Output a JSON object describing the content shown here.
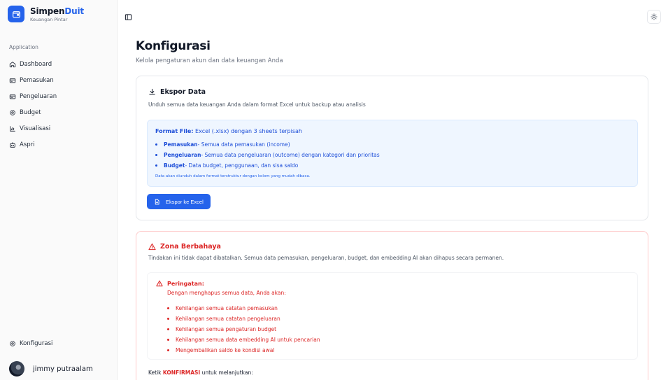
{
  "brand": {
    "name_part1": "Simpen",
    "name_part2": "Duit",
    "tagline": "Keuangan Pintar",
    "accent_color": "#2563eb"
  },
  "sidebar": {
    "group_label": "Application",
    "items": [
      {
        "label": "Dashboard",
        "icon": "home-icon"
      },
      {
        "label": "Pemasukan",
        "icon": "wallet-in-icon"
      },
      {
        "label": "Pengeluaran",
        "icon": "wallet-out-icon"
      },
      {
        "label": "Budget",
        "icon": "settings-icon"
      },
      {
        "label": "Visualisasi",
        "icon": "chart-icon"
      },
      {
        "label": "Aspri",
        "icon": "bot-icon"
      }
    ],
    "config_label": "Konfigurasi",
    "user_name": "jimmy putraalam"
  },
  "page": {
    "title": "Konfigurasi",
    "subtitle": "Kelola pengaturan akun dan data keuangan Anda"
  },
  "export": {
    "title": "Ekspor Data",
    "description": "Unduh semua data keuangan Anda dalam format Excel untuk backup atau analisis",
    "format_label": "Format File:",
    "format_value": " Excel (.xlsx) dengan 3 sheets terpisah",
    "items": [
      {
        "name": "Pemasukan",
        "desc": " - Semua data pemasukan (income)"
      },
      {
        "name": "Pengeluaran",
        "desc": " - Semua data pengeluaran (outcome) dengan kategori dan prioritas"
      },
      {
        "name": "Budget",
        "desc": " - Data budget, penggunaan, dan sisa saldo"
      }
    ],
    "note": "Data akan diunduh dalam format terstruktur dengan kolom yang mudah dibaca.",
    "button_label": "Ekspor ke Excel"
  },
  "danger": {
    "title": "Zona Berbahaya",
    "description": "Tindakan ini tidak dapat dibatalkan. Semua data pemasukan, pengeluaran, budget, dan embedding AI akan dihapus secara permanen.",
    "warning_title": "Peringatan:",
    "warning_intro": "Dengan menghapus semua data, Anda akan:",
    "warning_items": [
      "Kehilangan semua catatan pemasukan",
      "Kehilangan semua catatan pengeluaran",
      "Kehilangan semua pengaturan budget",
      "Kehilangan semua data embedding AI untuk pencarian",
      "Mengembalikan saldo ke kondisi awal"
    ],
    "confirm_prefix": "Ketik ",
    "confirm_keyword": "KONFIRMASI",
    "confirm_suffix": " untuk melanjutkan:",
    "color": "#dc2626"
  }
}
